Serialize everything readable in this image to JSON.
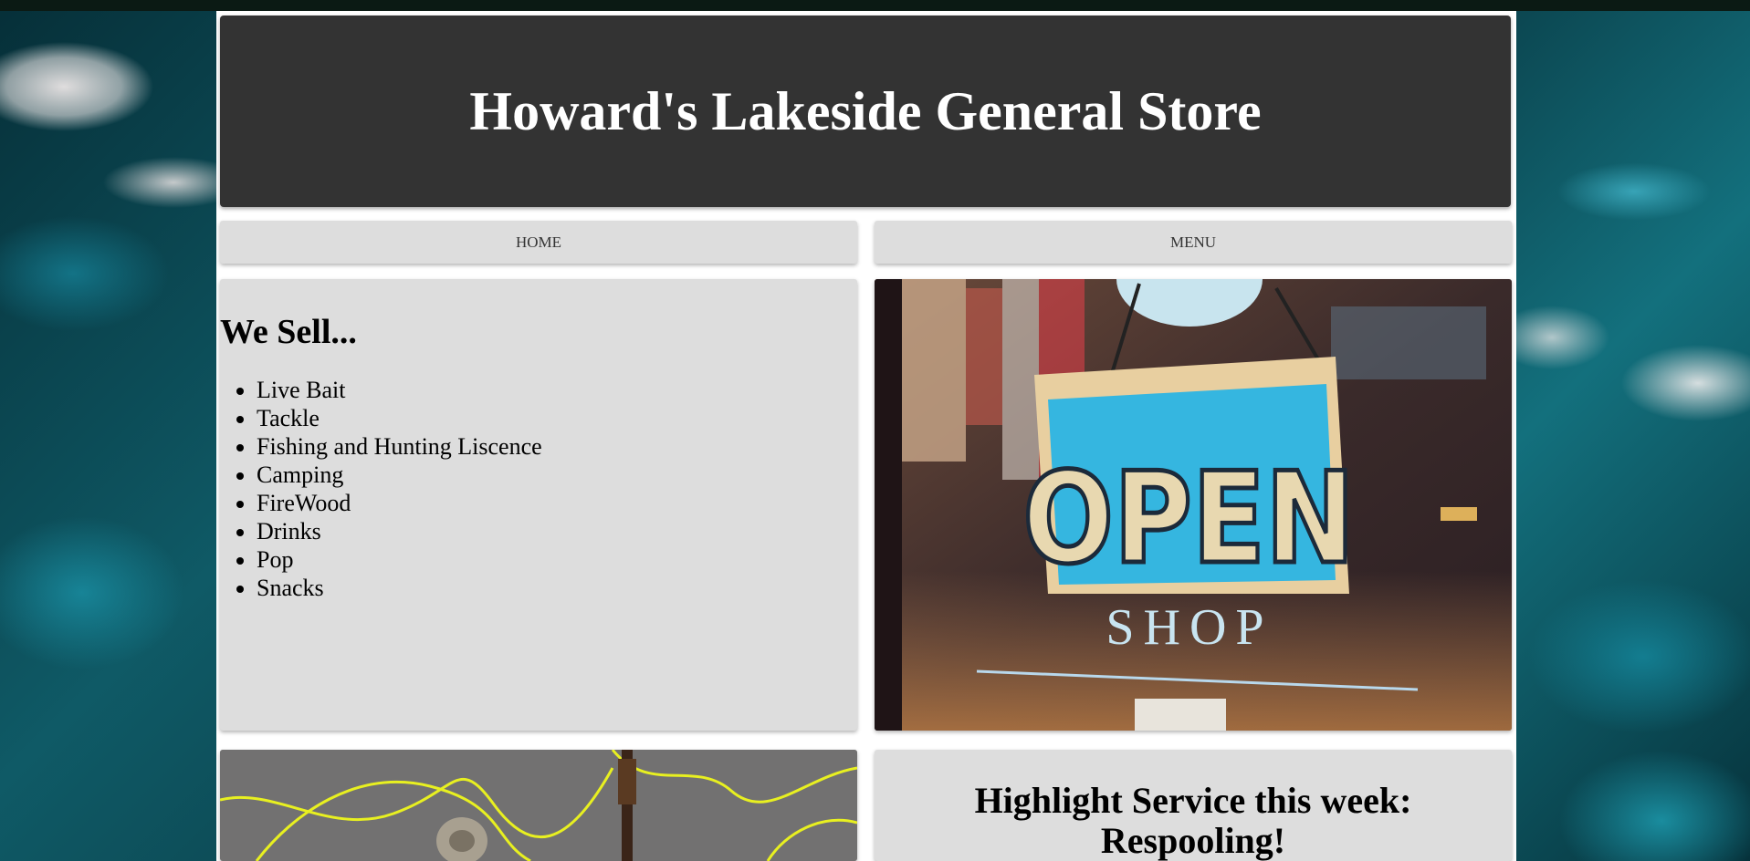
{
  "header": {
    "title": "Howard's Lakeside General Store"
  },
  "nav": {
    "home_label": "HOME",
    "menu_label": "MENU"
  },
  "we_sell": {
    "heading": "We Sell...",
    "items": [
      "Live Bait",
      "Tackle",
      "Fishing and Hunting Liscence",
      "Camping",
      "FireWood",
      "Drinks",
      "Pop",
      "Snacks"
    ]
  },
  "open_sign": {
    "sign_text": "OPEN",
    "shop_text": "SHOP"
  },
  "highlight": {
    "heading": "Highlight Service this week: Respooling!"
  }
}
